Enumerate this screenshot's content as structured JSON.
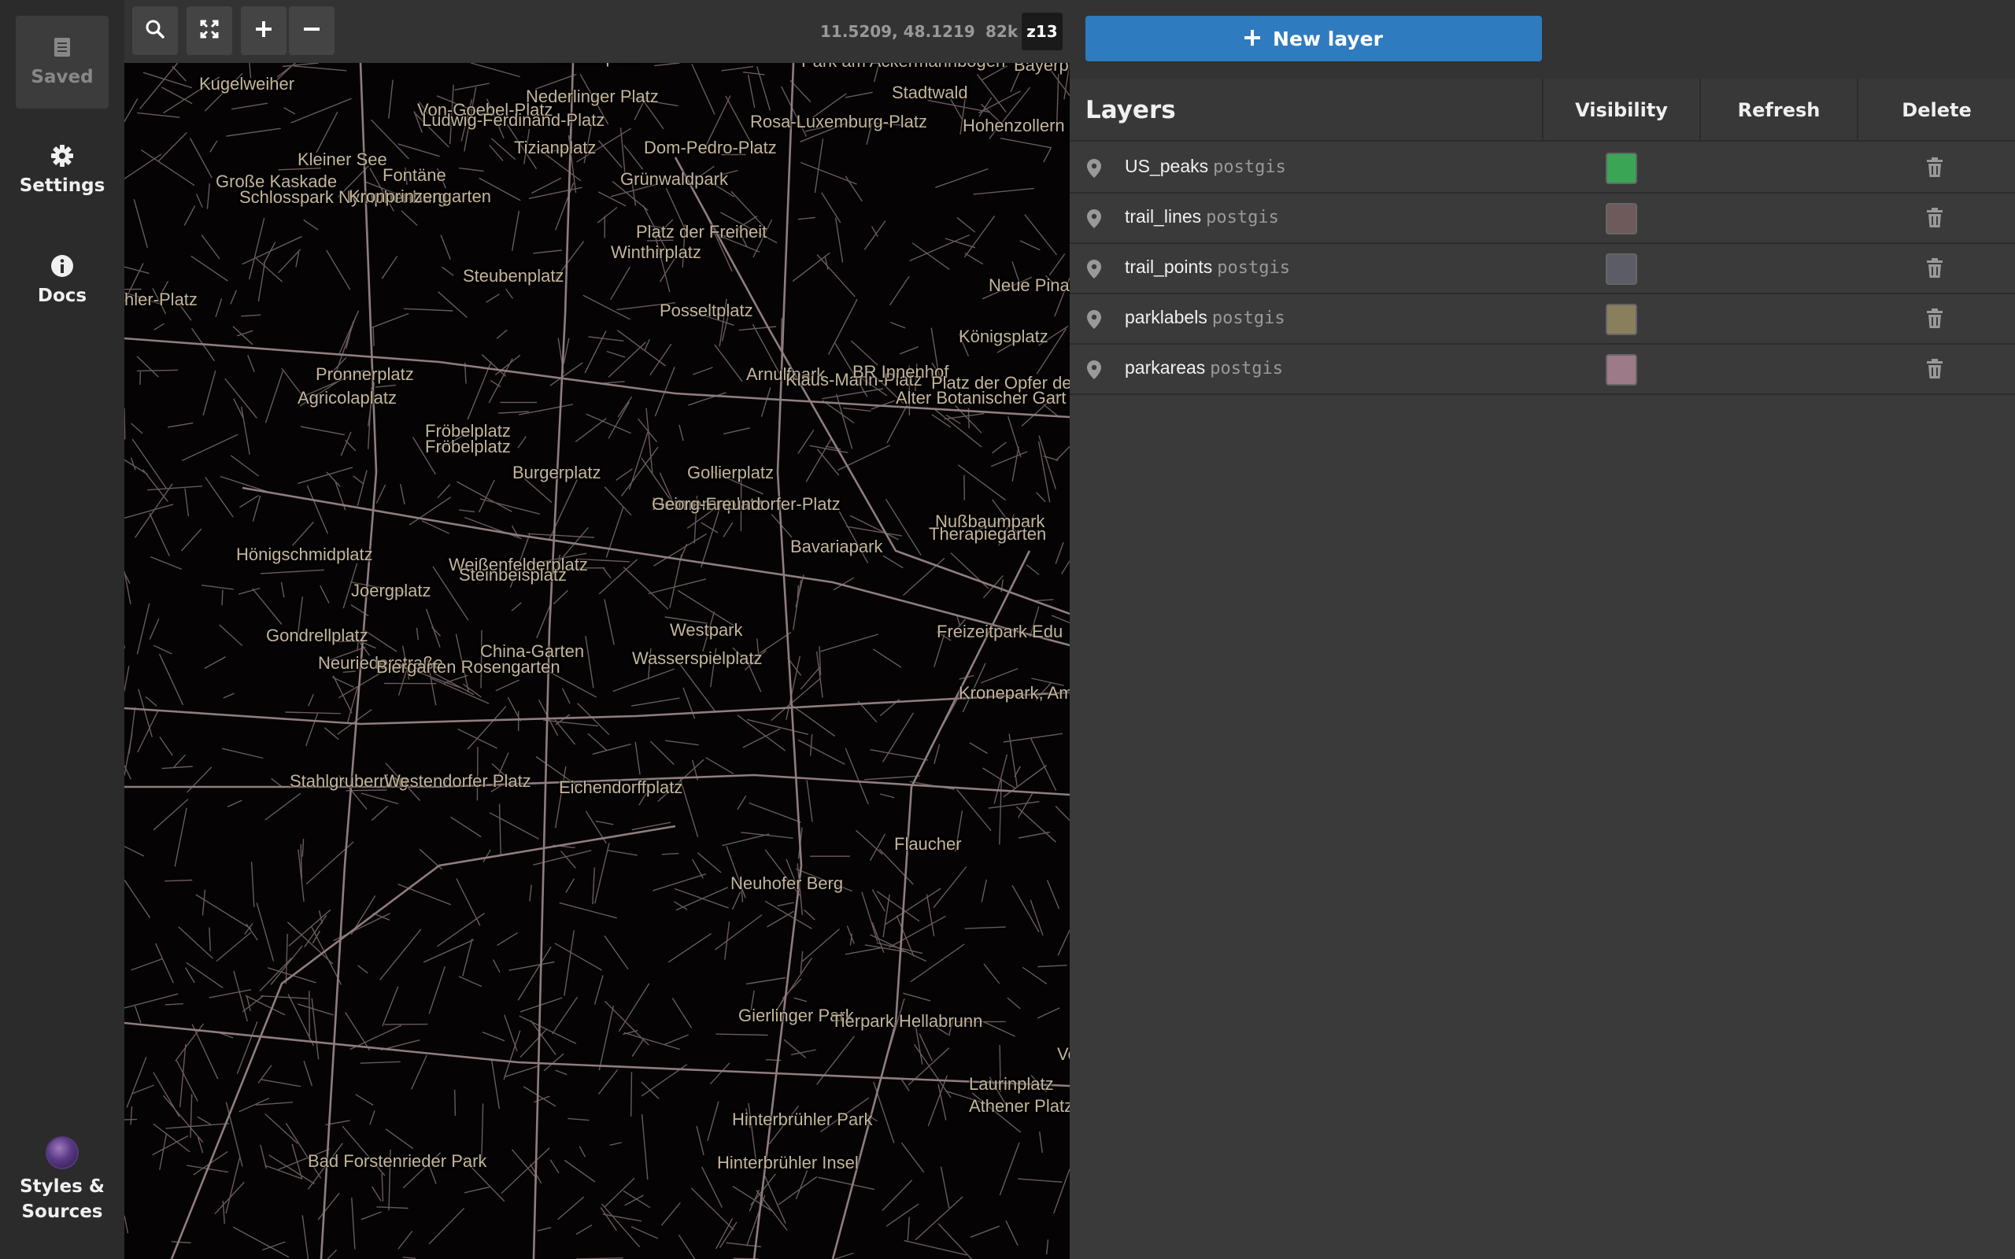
{
  "nav": {
    "saved_label": "Saved",
    "settings_label": "Settings",
    "docs_label": "Docs",
    "styles_label_line1": "Styles &",
    "styles_label_line2": "Sources"
  },
  "toolbar": {
    "coords": "11.5209, 48.1219",
    "count": "82k",
    "zoom": "z13",
    "buttons": [
      "search-icon",
      "fullscreen-icon",
      "zoom-in-icon",
      "zoom-out-icon"
    ]
  },
  "map": {
    "labels": [
      "Wertachplatz",
      "Park am Ackermannbogen",
      "Bayerplatz",
      "Kugelweiher",
      "Nederlinger Platz",
      "Stadtwald",
      "Von-Goebel-Platz",
      "Ludwig-Ferdinand-Platz",
      "Rosa-Luxemburg-Platz",
      "Hohenzollern",
      "Tizianplatz",
      "Dom-Pedro-Platz",
      "Kleiner See",
      "Fontäne",
      "Große Kaskade",
      "Grünwaldpark",
      "Schlosspark Nymphenburg",
      "Kronprinzengarten",
      "Platz der Freiheit",
      "Winthirplatz",
      "hler-Platz",
      "Steubenplatz",
      "Neue Pina",
      "Posseltplatz",
      "Königsplatz",
      "Pronnerplatz",
      "Arnulfpark",
      "Klaus-Mann-Platz",
      "BR Innenhof",
      "Platz der Opfer de",
      "Agricolaplatz",
      "Alter Botanischer Gart",
      "Fröbelplatz",
      "Fröbelplatz",
      "Burgerplatz",
      "Gollierplatz",
      "Heimeranplatz",
      "Georg-Freundorfer-Platz",
      "Nußbaumpark",
      "Therapiegarten",
      "Bavariapark",
      "Hönigschmidplatz",
      "Weißenfelderplatz",
      "Steinbeisplatz",
      "Joergplatz",
      "Westpark",
      "Freizeitpark Edu",
      "Gondrellplatz",
      "China-Garten",
      "Wasserspielplatz",
      "Neuriederstraße",
      "Biergarten Rosengarten",
      "Kronepark, Am",
      "Stahlgruberring",
      "Westendorfer Platz",
      "Eichendorffplatz",
      "Flaucher",
      "Neuhofer Berg",
      "Gierlinger Park",
      "Tierpark Hellabrunn",
      "Laurinplatz",
      "Athener Platz",
      "Hinterbrühler Park",
      "Bad Forstenrieder Park",
      "Hinterbrühler Insel",
      "Vo"
    ]
  },
  "panel": {
    "new_layer_label": "New layer",
    "headers": {
      "layers": "Layers",
      "visibility": "Visibility",
      "refresh": "Refresh",
      "delete": "Delete"
    },
    "layers": [
      {
        "name": "US_peaks",
        "source": "postgis",
        "color": "#3aa655"
      },
      {
        "name": "trail_lines",
        "source": "postgis",
        "color": "#6e5a5a"
      },
      {
        "name": "trail_points",
        "source": "postgis",
        "color": "#5c5c66"
      },
      {
        "name": "parklabels",
        "source": "postgis",
        "color": "#8a7f5c"
      },
      {
        "name": "parkareas",
        "source": "postgis",
        "color": "#9c7a88"
      }
    ]
  }
}
